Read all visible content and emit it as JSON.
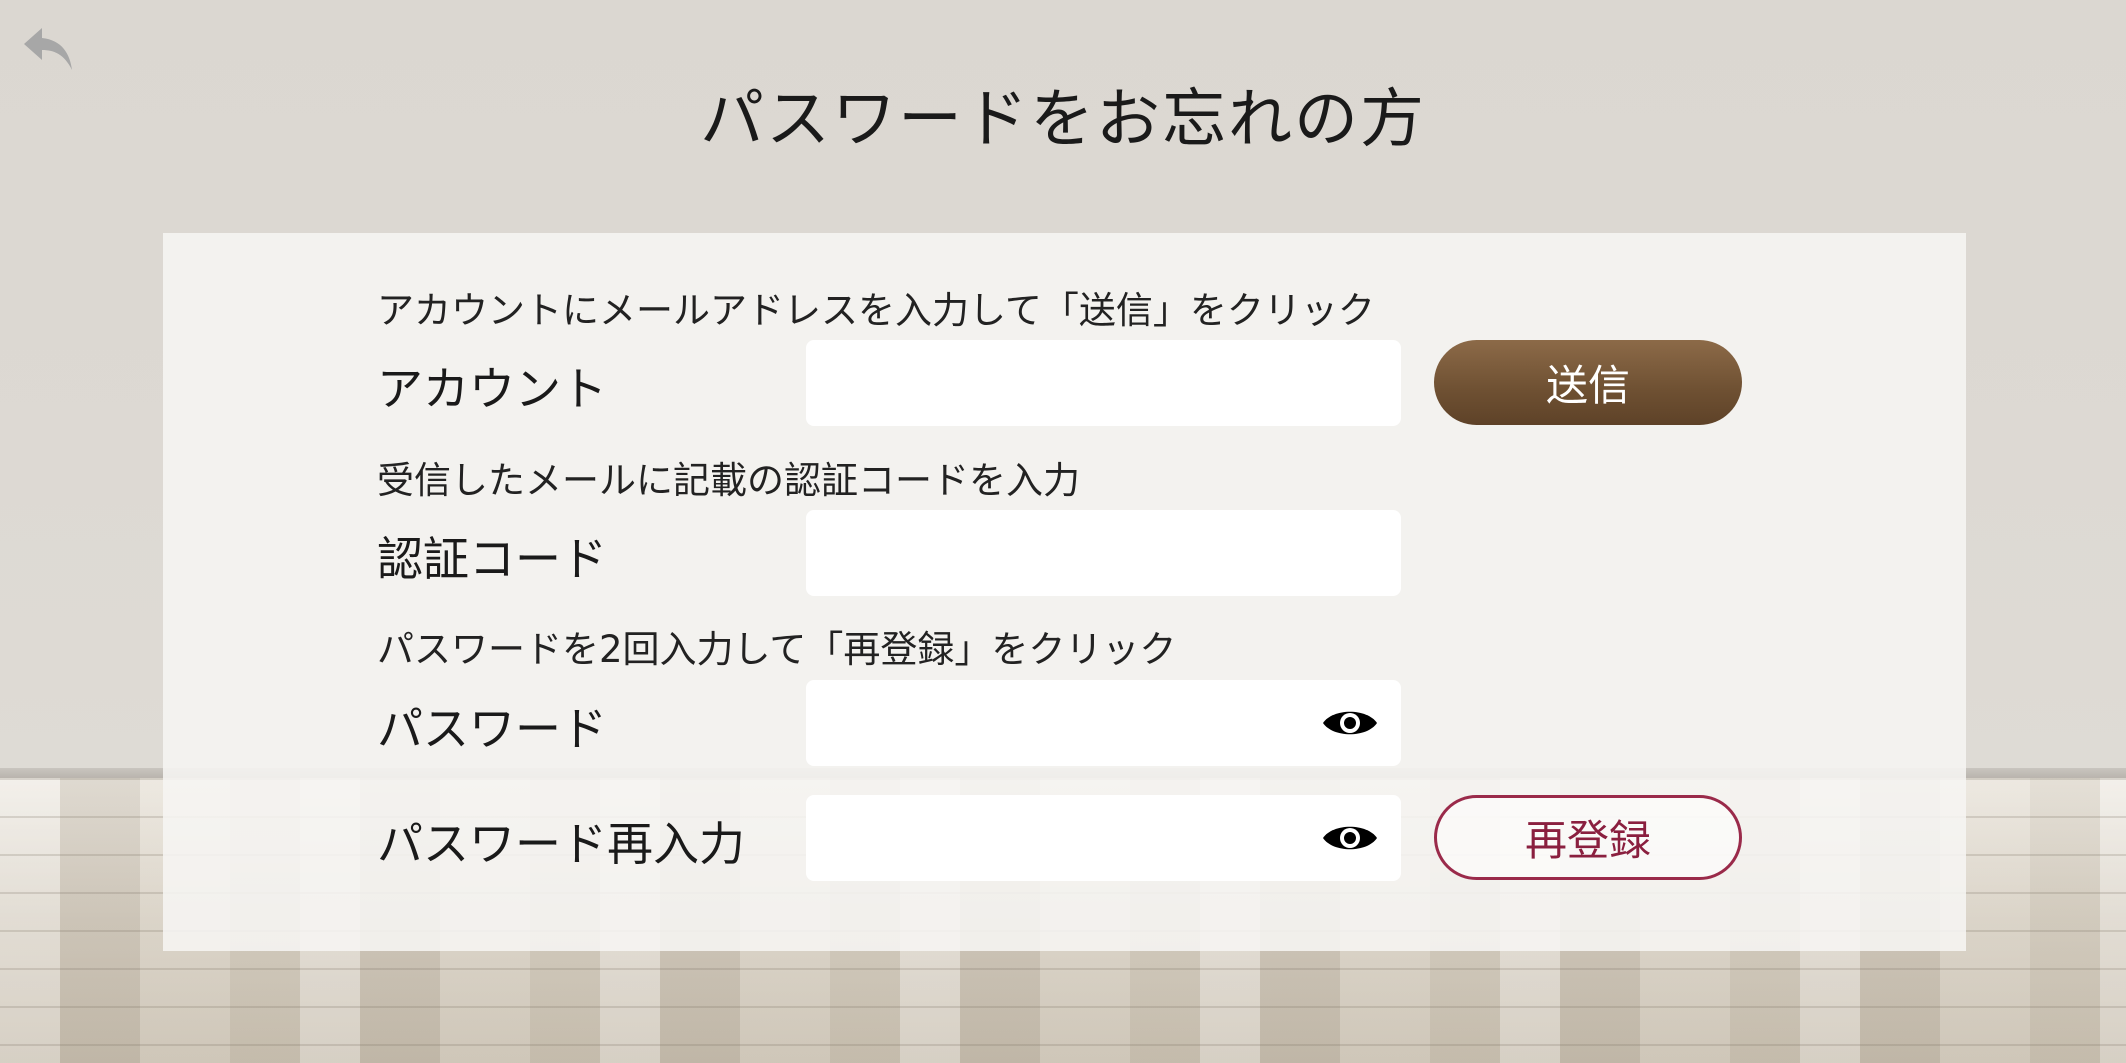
{
  "page": {
    "title": "パスワードをお忘れの方"
  },
  "back_button": {
    "icon": "back-arrow-icon"
  },
  "account_section": {
    "instruction": "アカウントにメールアドレスを入力して「送信」をクリック",
    "label": "アカウント",
    "value": "",
    "send_label": "送信"
  },
  "code_section": {
    "instruction": "受信したメールに記載の認証コードを入力",
    "label": "認証コード",
    "value": ""
  },
  "password_section": {
    "instruction": "パスワードを2回入力して「再登録」をクリック",
    "password_label": "パスワード",
    "password_value": "",
    "confirm_label": "パスワード再入力",
    "confirm_value": "",
    "eye_icon": "eye-icon",
    "register_label": "再登録"
  },
  "colors": {
    "send_button": "#6e5032",
    "register_button": "#8a1f3f"
  }
}
